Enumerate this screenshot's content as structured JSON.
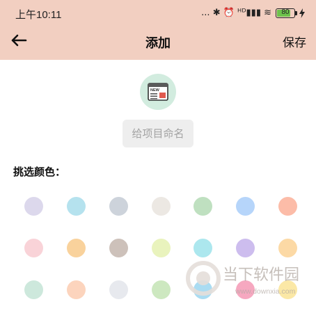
{
  "status_bar": {
    "time": "上午10:11",
    "indicators": "... ✱ ⏰ ᴴᴰ▮▮▮ ≋",
    "battery_level": "80",
    "battery_fraction": 0.8,
    "charging_icon": "lightning-icon"
  },
  "header": {
    "back_icon": "arrow-left-icon",
    "title": "添加",
    "save_label": "保存"
  },
  "project": {
    "icon": "newspaper-icon",
    "name_placeholder": "给项目命名",
    "name_value": ""
  },
  "color_picker": {
    "label": "挑选颜色：",
    "swatches": [
      "#dcd8ec",
      "#b5e2ee",
      "#cdd3db",
      "#ece8e3",
      "#bfe0c0",
      "#b6d5fa",
      "#fcbca8",
      "#f9d3d8",
      "#f9d29c",
      "#cdc1ba",
      "#e9f3bd",
      "#ace7ee",
      "#cdbdee",
      "#fcd9a5",
      "#cde8dc",
      "#fcd4bd",
      "#e7e9ee",
      "#cde8c0",
      "#aadcf2",
      "#f6a8c0",
      "#fbe8a6"
    ]
  },
  "watermark": {
    "brand": "当下软件园",
    "url": "www.downxia.com"
  }
}
